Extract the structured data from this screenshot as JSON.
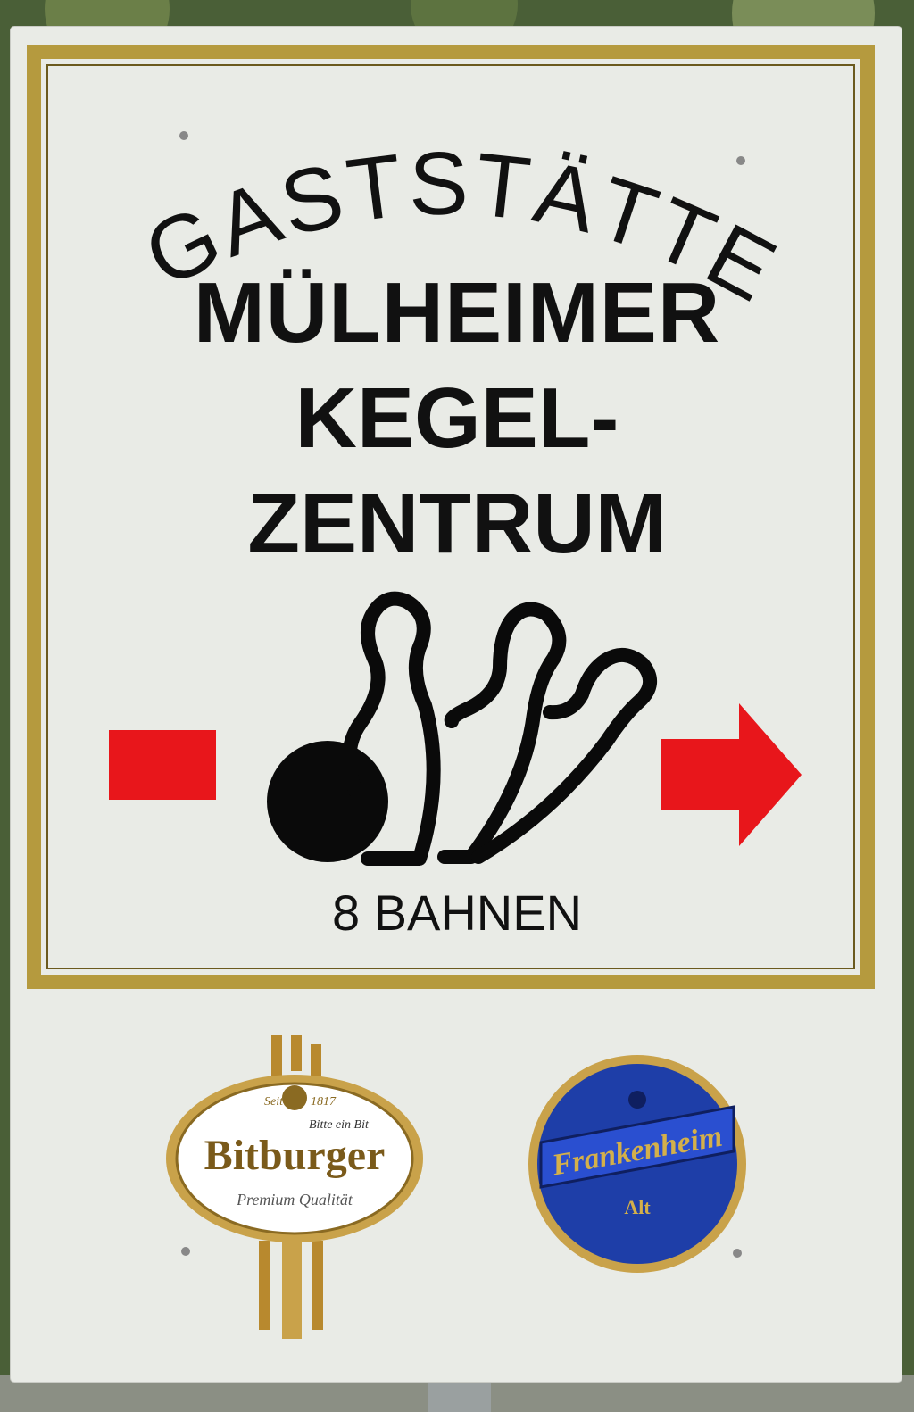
{
  "sign": {
    "arched_title": "GASTSTÄTTE",
    "name_line1": "MÜLHEIMER",
    "name_line2": "KEGEL-",
    "name_line3": "ZENTRUM",
    "lanes": "8 BAHNEN"
  },
  "logos": {
    "bitburger": {
      "since": "Seit",
      "year": "1817",
      "slogan": "Bitte ein Bit",
      "brand": "Bitburger",
      "tagline": "Premium Qualität"
    },
    "frankenheim": {
      "brand": "Frankenheim",
      "type": "Alt"
    }
  },
  "colors": {
    "gold": "#b59a3e",
    "red": "#e8161b",
    "blue": "#1e3ea8",
    "sign": "#e9ebe6"
  }
}
